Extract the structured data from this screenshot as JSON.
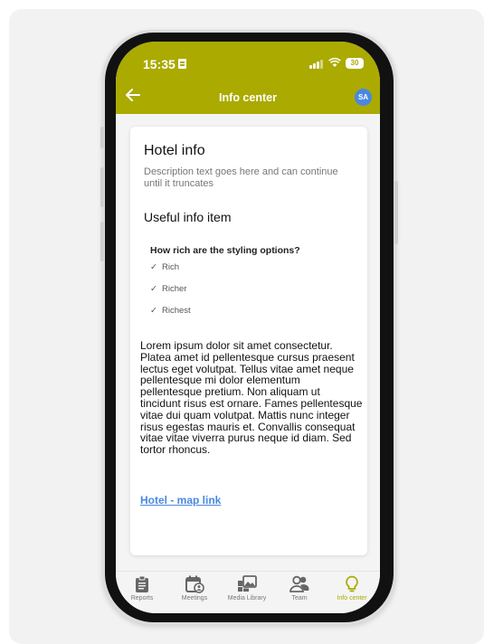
{
  "status_bar": {
    "time": "15:35",
    "battery": "30"
  },
  "app_bar": {
    "title": "Info center",
    "avatar_initials": "SA"
  },
  "card": {
    "title": "Hotel info",
    "description": "Description text goes here and can continue until it truncates",
    "useful_title": "Useful info item",
    "question": "How rich are the styling options?",
    "options": [
      "Rich",
      "Richer",
      "Richest"
    ],
    "body": "Lorem ipsum dolor sit amet consectetur. Platea amet id pellentesque cursus praesent lectus eget volutpat. Tellus vitae amet neque pellentesque mi dolor elementum pellentesque pretium. Non aliquam ut tincidunt risus est ornare. Fames pellentesque vitae dui quam volutpat. Mattis nunc integer risus egestas mauris et. Convallis consequat vitae vitae viverra purus neque id diam. Sed tortor rhoncus.",
    "link": "Hotel - map link"
  },
  "nav": {
    "items": [
      {
        "label": "Reports",
        "icon": "clipboard-icon"
      },
      {
        "label": "Meetings",
        "icon": "calendar-person-icon"
      },
      {
        "label": "Media Library",
        "icon": "images-icon"
      },
      {
        "label": "Team",
        "icon": "team-icon"
      },
      {
        "label": "Info center",
        "icon": "lightbulb-icon"
      }
    ],
    "active": "Info center"
  },
  "colors": {
    "accent": "#aaaa00",
    "link": "#4a88e0",
    "avatar": "#4a88e0"
  }
}
